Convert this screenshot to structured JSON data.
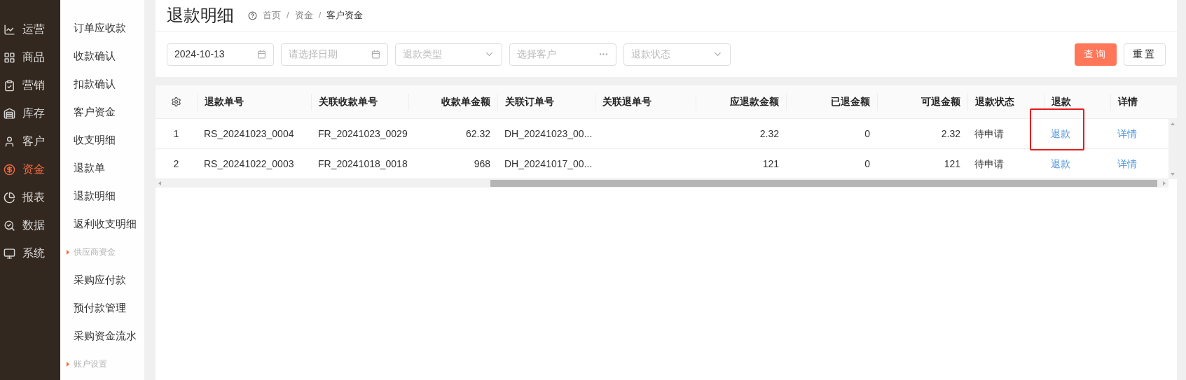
{
  "nav": [
    {
      "label": "运营",
      "selected": false
    },
    {
      "label": "商品",
      "selected": false
    },
    {
      "label": "营销",
      "selected": false
    },
    {
      "label": "库存",
      "selected": false
    },
    {
      "label": "客户",
      "selected": false
    },
    {
      "label": "资金",
      "selected": true
    },
    {
      "label": "报表",
      "selected": false
    },
    {
      "label": "数据",
      "selected": false
    },
    {
      "label": "系统",
      "selected": false
    }
  ],
  "submenu": [
    {
      "kind": "item",
      "label": "订单应收款"
    },
    {
      "kind": "item",
      "label": "收款确认"
    },
    {
      "kind": "item",
      "label": "扣款确认"
    },
    {
      "kind": "item",
      "label": "客户资金"
    },
    {
      "kind": "item",
      "label": "收支明细"
    },
    {
      "kind": "item",
      "label": "退款单"
    },
    {
      "kind": "item",
      "label": "退款明细"
    },
    {
      "kind": "item",
      "label": "返利收支明细"
    },
    {
      "kind": "group",
      "label": "供应商资金"
    },
    {
      "kind": "item",
      "label": "采购应付款"
    },
    {
      "kind": "item",
      "label": "预付款管理"
    },
    {
      "kind": "item",
      "label": "采购资金流水"
    },
    {
      "kind": "group",
      "label": "账户设置"
    }
  ],
  "page": {
    "title": "退款明细",
    "breadcrumb": [
      {
        "kind": "link",
        "text": "首页"
      },
      {
        "kind": "separator",
        "text": "/"
      },
      {
        "kind": "link",
        "text": "资金"
      },
      {
        "kind": "separator",
        "text": "/"
      },
      {
        "kind": "current",
        "text": "客户资金"
      }
    ]
  },
  "filters": [
    {
      "kind": "date",
      "value": "2024-10-13"
    },
    {
      "kind": "date",
      "placeholder": "请选择日期"
    },
    {
      "kind": "select",
      "placeholder": "退款类型"
    },
    {
      "kind": "picker",
      "placeholder": "选择客户"
    },
    {
      "kind": "select",
      "placeholder": "退款状态"
    }
  ],
  "buttons": [
    {
      "label": "查询",
      "primary": true
    },
    {
      "label": "重置",
      "primary": false
    }
  ],
  "table": {
    "columns": [
      "退款单号",
      "关联收款单号",
      "收款单金额",
      "关联订单号",
      "关联退单号",
      "应退款金额",
      "已退金额",
      "可退金额",
      "退款状态",
      "退款",
      "详情"
    ],
    "rows": [
      {
        "index": "1",
        "cells": [
          "RS_20241023_0004",
          "FR_20241023_0029",
          "62.32",
          "DH_20241023_00...",
          "",
          "2.32",
          "0",
          "2.32",
          "待申请"
        ],
        "refund": "退款",
        "detail": "详情",
        "highlighted": true
      },
      {
        "index": "2",
        "cells": [
          "RS_20241022_0003",
          "FR_20241018_0018",
          "968",
          "DH_20241017_00...",
          "",
          "121",
          "0",
          "121",
          "待申请"
        ],
        "refund": "退款",
        "detail": "详情",
        "highlighted": false
      }
    ]
  }
}
